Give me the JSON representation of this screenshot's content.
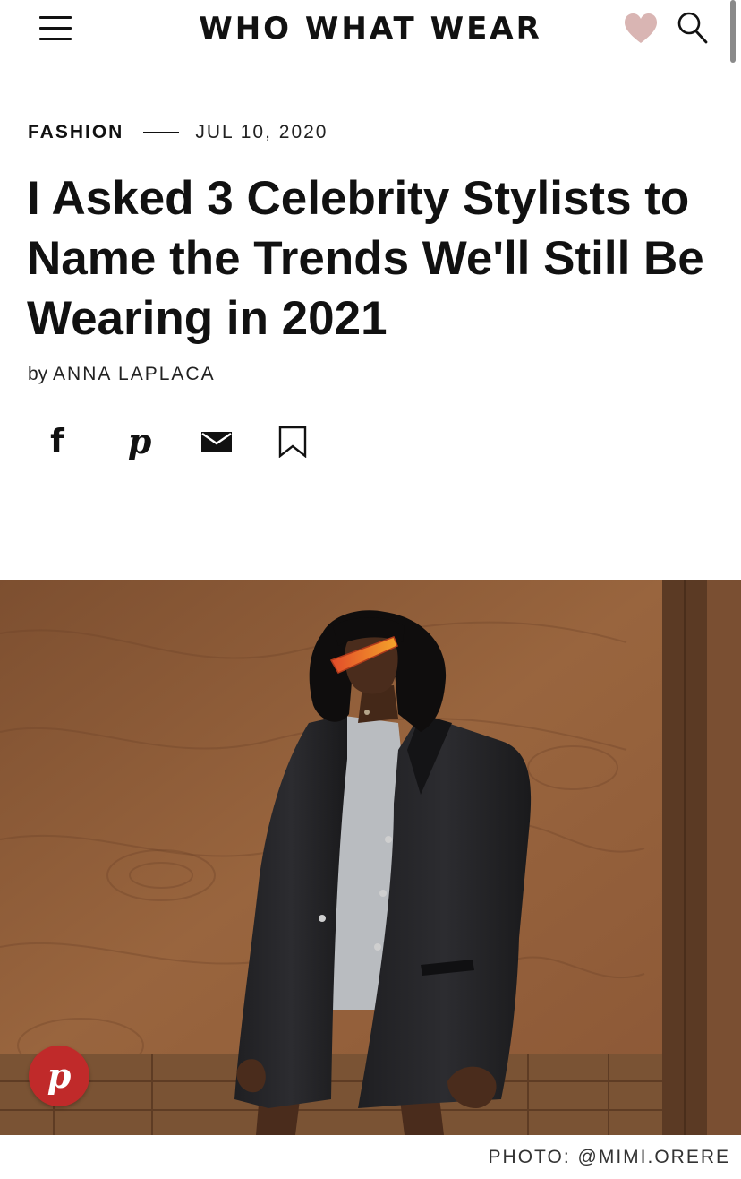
{
  "header": {
    "logo_text": "WHO WHAT WEAR",
    "menu_icon": "hamburger-menu-icon",
    "heart_icon": "heart-icon",
    "search_icon": "search-icon",
    "heart_color": "#d9b5b3"
  },
  "article": {
    "category": "FASHION",
    "date": "JUL 10, 2020",
    "headline": "I Asked 3 Celebrity Stylists to Name the Trends We'll Still Be Wearing in 2021",
    "byline_prefix": "by",
    "author": "ANNA LAPLACA"
  },
  "share": {
    "icons": [
      "facebook-icon",
      "pinterest-icon",
      "email-icon",
      "bookmark-icon"
    ]
  },
  "hero": {
    "pin_button_color": "#c02a2a",
    "photo_credit": "PHOTO: @MIMI.ORERE"
  }
}
